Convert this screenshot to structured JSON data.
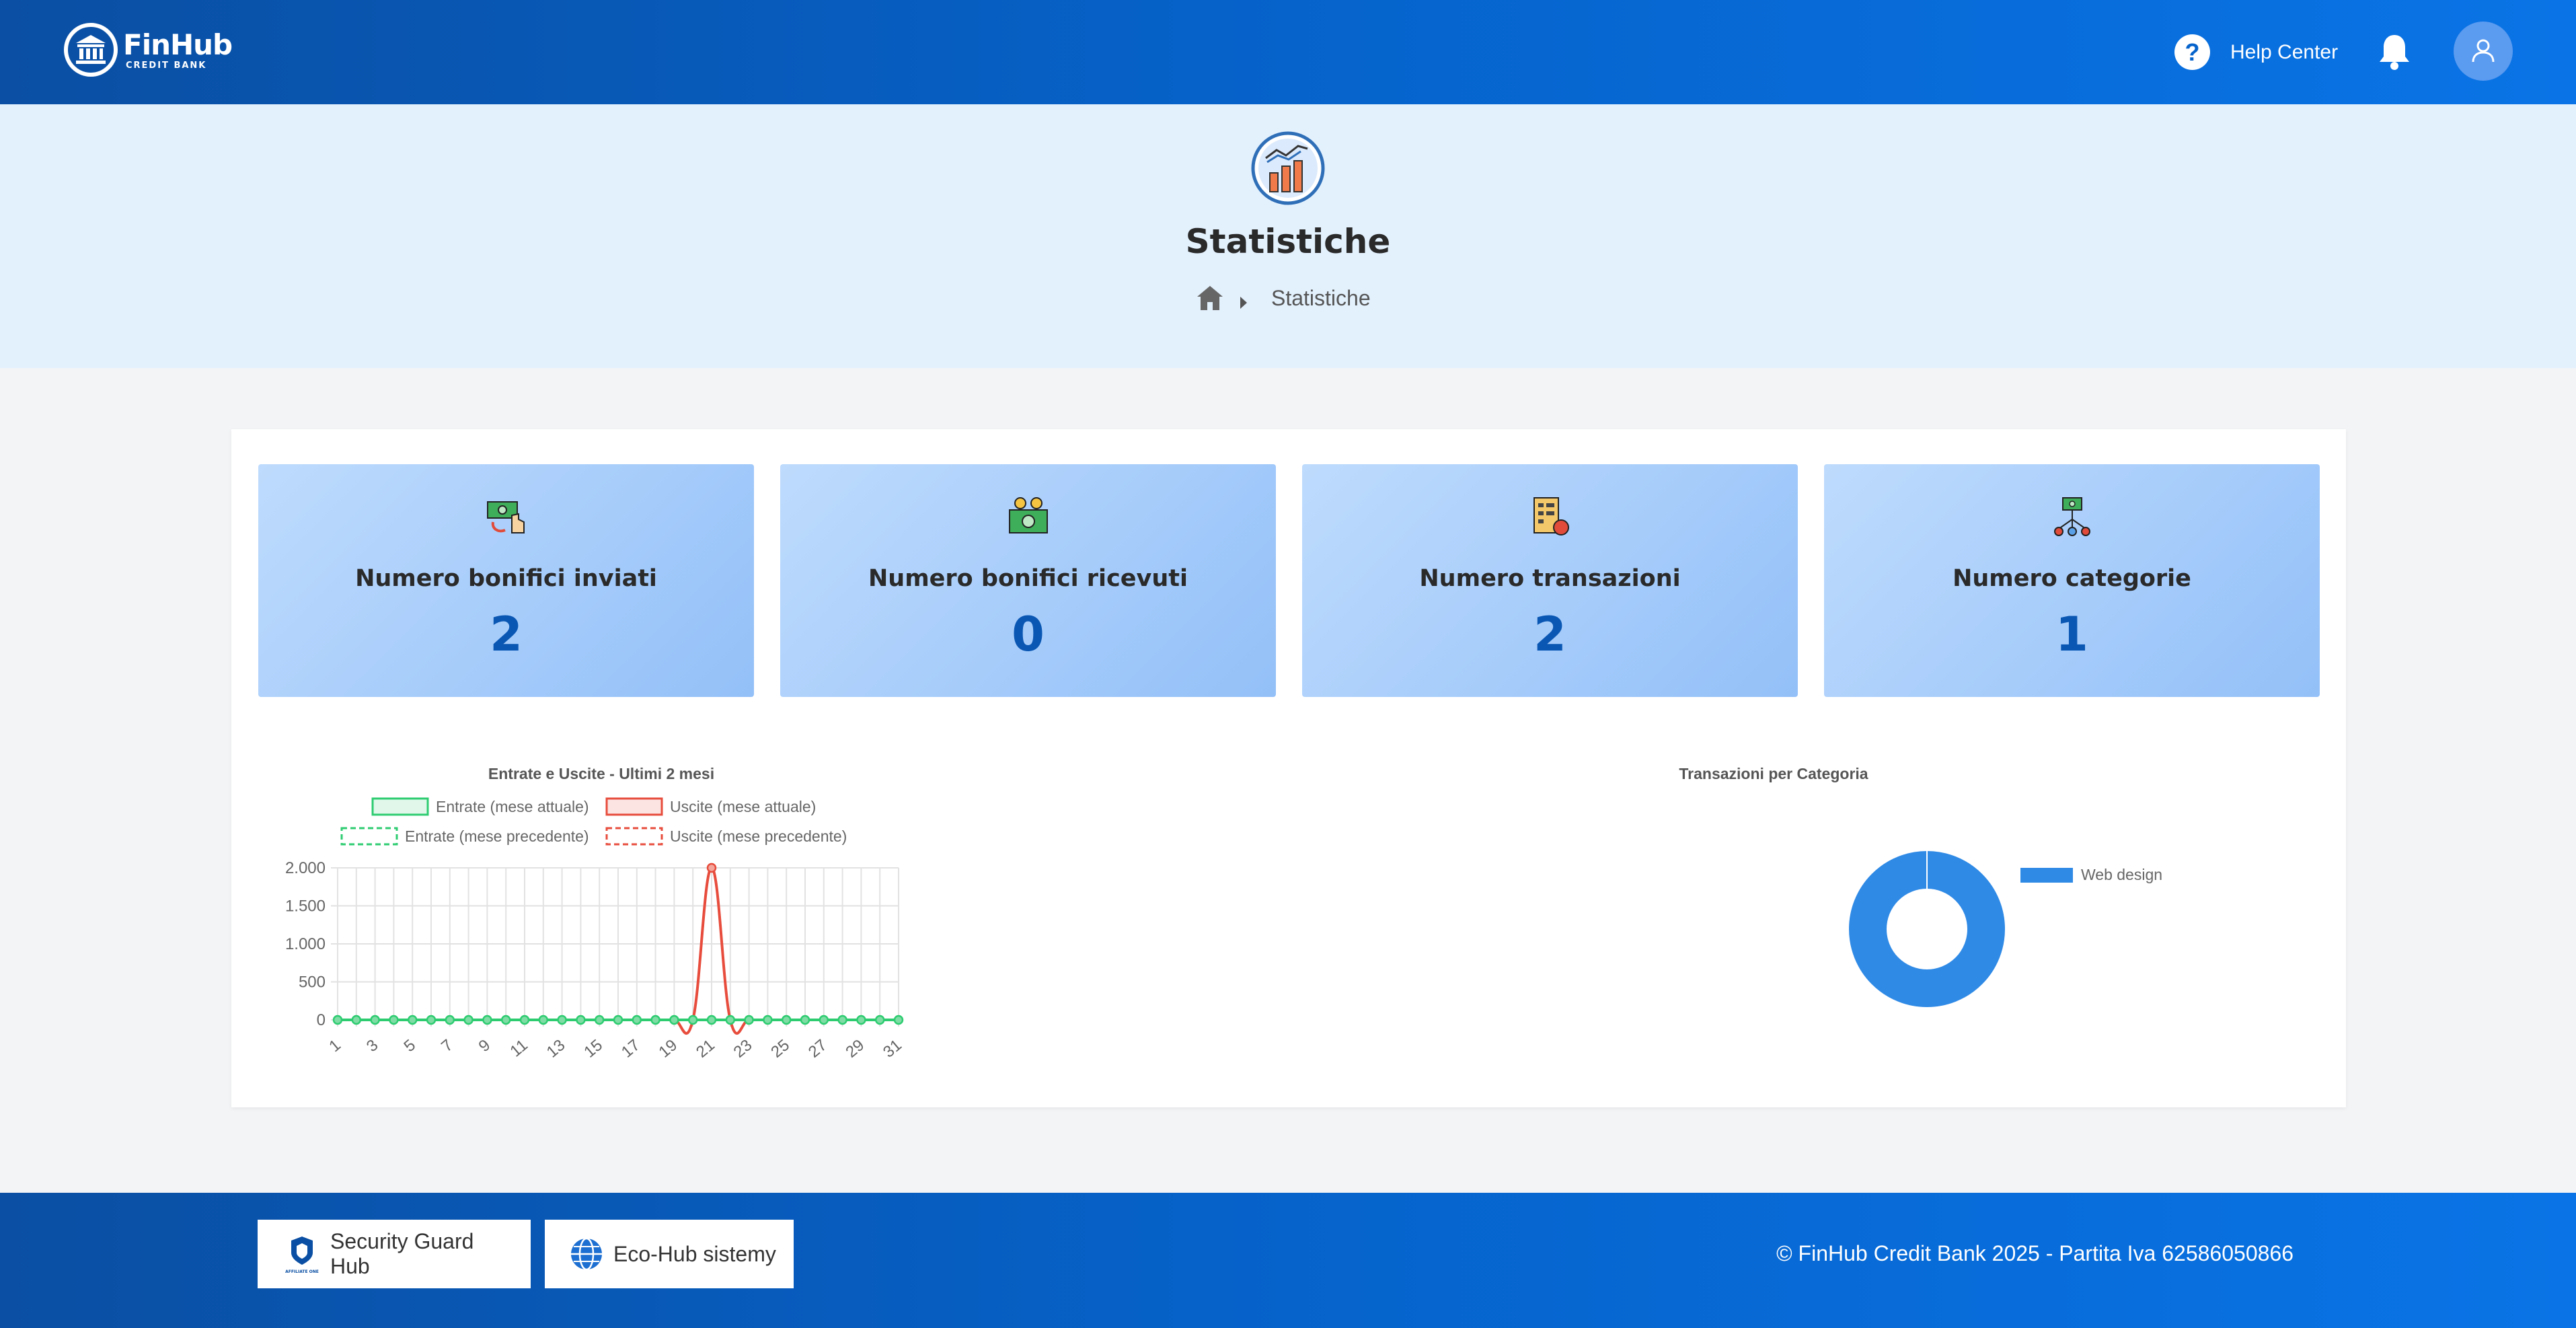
{
  "header": {
    "brand_name": "FinHub",
    "brand_sub": "CREDIT BANK",
    "help_label": "Help Center",
    "help_glyph": "?"
  },
  "hero": {
    "title": "Statistiche",
    "breadcrumb": [
      "Statistiche"
    ]
  },
  "stats": [
    {
      "label": "Numero bonifici inviati",
      "value": "2",
      "icon": "money-transfer-icon"
    },
    {
      "label": "Numero bonifici ricevuti",
      "value": "0",
      "icon": "money-received-icon"
    },
    {
      "label": "Numero transazioni",
      "value": "2",
      "icon": "transactions-icon"
    },
    {
      "label": "Numero categorie",
      "value": "1",
      "icon": "categories-icon"
    }
  ],
  "chart_data": [
    {
      "type": "line",
      "title": "Entrate e Uscite - Ultimi 2 mesi",
      "x": [
        1,
        2,
        3,
        4,
        5,
        6,
        7,
        8,
        9,
        10,
        11,
        12,
        13,
        14,
        15,
        16,
        17,
        18,
        19,
        20,
        21,
        22,
        23,
        24,
        25,
        26,
        27,
        28,
        29,
        30,
        31
      ],
      "x_tick_labels": [
        "1",
        "3",
        "5",
        "7",
        "9",
        "11",
        "13",
        "15",
        "17",
        "19",
        "21",
        "23",
        "25",
        "27",
        "29",
        "31"
      ],
      "y_tick_labels": [
        "2.000",
        "1.500",
        "1.000",
        "500",
        "0"
      ],
      "ylim": [
        0,
        2000
      ],
      "grid": true,
      "legend": "top",
      "series": [
        {
          "name": "Entrate (mese attuale)",
          "color": "#2ecc71",
          "dashed": false,
          "values": [
            0,
            0,
            0,
            0,
            0,
            0,
            0,
            0,
            0,
            0,
            0,
            0,
            0,
            0,
            0,
            0,
            0,
            0,
            0,
            0,
            0,
            0,
            0,
            0,
            0,
            0,
            0,
            0,
            0,
            0,
            0
          ]
        },
        {
          "name": "Uscite (mese attuale)",
          "color": "#e74c3c",
          "dashed": false,
          "values": [
            0,
            0,
            0,
            0,
            0,
            0,
            0,
            0,
            0,
            0,
            0,
            0,
            0,
            0,
            0,
            0,
            0,
            0,
            0,
            0,
            2000,
            0,
            0,
            0,
            0,
            0,
            0,
            0,
            0,
            0,
            0
          ]
        },
        {
          "name": "Entrate (mese precedente)",
          "color": "#2ecc71",
          "dashed": true,
          "values": []
        },
        {
          "name": "Uscite (mese precedente)",
          "color": "#e74c3c",
          "dashed": true,
          "values": []
        }
      ]
    },
    {
      "type": "pie",
      "title": "Transazioni per Categoria",
      "legend": "right",
      "labels": [
        "Web design"
      ],
      "values": [
        1
      ],
      "colors": [
        "#2f8ae6"
      ]
    }
  ],
  "footer": {
    "security_label": "Security Guard Hub",
    "security_badge": "AFFILIATE ONE",
    "eco_label": "Eco-Hub sistemy",
    "copyright": "© FinHub Credit Bank 2025 - Partita Iva 62586050866"
  },
  "colors": {
    "brand_blue": "#0663cb",
    "hero_bg": "#e3f1fd",
    "stat_value": "#0a57b3"
  }
}
